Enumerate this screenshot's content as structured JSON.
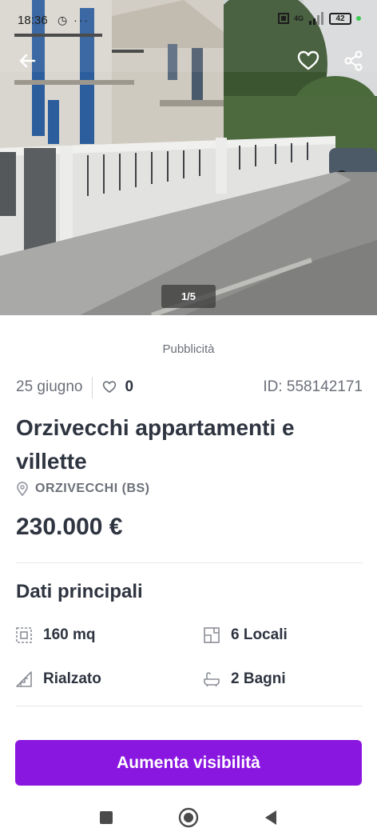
{
  "status_bar": {
    "time": "18:36",
    "left_icons": "◷ ···",
    "network": "4G",
    "battery": "42"
  },
  "gallery": {
    "counter": "1/5"
  },
  "ad_label": "Pubblicità",
  "listing": {
    "date": "25 giugno",
    "favorites_count": "0",
    "id": "ID: 558142171",
    "title": "Orzivecchi appartamenti e villette",
    "location": "ORZIVECCHI (BS)",
    "price": "230.000 €"
  },
  "main_data": {
    "title": "Dati principali",
    "features": [
      {
        "icon": "area-icon",
        "label": "160 mq"
      },
      {
        "icon": "rooms-icon",
        "label": "6 Locali"
      },
      {
        "icon": "floor-icon",
        "label": "Rialzato"
      },
      {
        "icon": "bathtub-icon",
        "label": "2 Bagni"
      }
    ]
  },
  "cta": {
    "label": "Aumenta visibilità",
    "color": "#8a17e0"
  }
}
